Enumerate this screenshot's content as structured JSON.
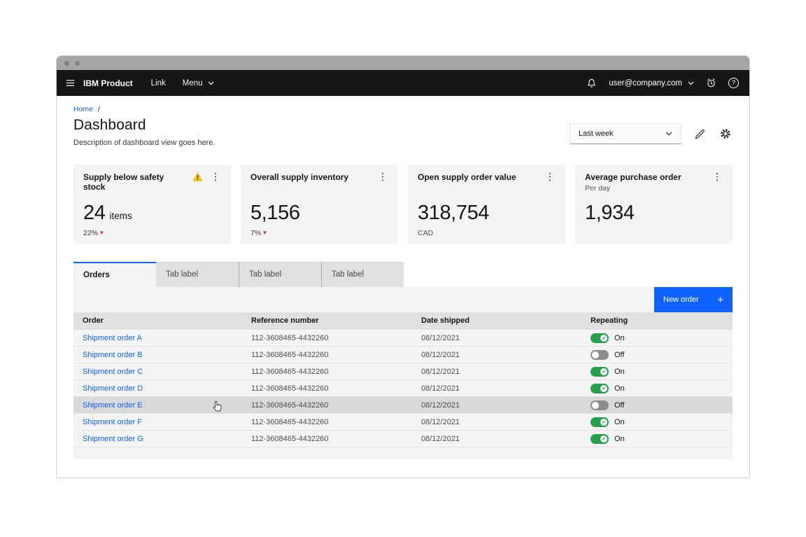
{
  "header": {
    "product": "IBM Product",
    "links": [
      "Link",
      "Menu"
    ],
    "user_email": "user@company.com"
  },
  "breadcrumb": {
    "home": "Home",
    "separator": "/"
  },
  "page": {
    "title": "Dashboard",
    "description": "Description of dashboard view goes here."
  },
  "filters": {
    "period": "Last week"
  },
  "cards": [
    {
      "title": "Supply below safety stock",
      "value": "24",
      "suffix": "items",
      "delta": "22%",
      "has_warning": true
    },
    {
      "title": "Overall supply inventory",
      "value": "5,156",
      "delta": "7%"
    },
    {
      "title": "Open supply order value",
      "value": "318,754",
      "footnote": "CAD"
    },
    {
      "title": "Average purchase order",
      "subtitle": "Per day",
      "value": "1,934"
    }
  ],
  "tabs": [
    {
      "label": "Orders",
      "active": true
    },
    {
      "label": "Tab label",
      "active": false
    },
    {
      "label": "Tab label",
      "active": false
    },
    {
      "label": "Tab label",
      "active": false
    }
  ],
  "table": {
    "new_order_label": "New order",
    "columns": [
      "Order",
      "Reference number",
      "Date shipped",
      "Repeating"
    ],
    "rows": [
      {
        "order": "Shipment order A",
        "reference": "112-3608465-4432260",
        "date_shipped": "08/12/2021",
        "state": "on",
        "state_label": "On",
        "hovered": false
      },
      {
        "order": "Shipment order B",
        "reference": "112-3608465-4432260",
        "date_shipped": "08/12/2021",
        "state": "off",
        "state_label": "Off",
        "hovered": false
      },
      {
        "order": "Shipment order C",
        "reference": "112-3608465-4432260",
        "date_shipped": "08/12/2021",
        "state": "on",
        "state_label": "On",
        "hovered": false
      },
      {
        "order": "Shipment order D",
        "reference": "112-3608465-4432260",
        "date_shipped": "08/12/2021",
        "state": "on",
        "state_label": "On",
        "hovered": false
      },
      {
        "order": "Shipment order E",
        "reference": "112-3608465-4432260",
        "date_shipped": "08/12/2021",
        "state": "off",
        "state_label": "Off",
        "hovered": true
      },
      {
        "order": "Shipment order F",
        "reference": "112-3608465-4432260",
        "date_shipped": "08/12/2021",
        "state": "on",
        "state_label": "On",
        "hovered": false
      },
      {
        "order": "Shipment order G",
        "reference": "112-3608465-4432260",
        "date_shipped": "08/12/2021",
        "state": "on",
        "state_label": "On",
        "hovered": false
      }
    ]
  },
  "icons": {
    "overflow": "⋮",
    "caret_down": "▾",
    "plus": "+",
    "help": "?"
  },
  "colors": {
    "accent": "#0f62fe",
    "header_bg": "#161616",
    "link": "#0f62fe",
    "toggle_on": "#24a148",
    "toggle_off": "#8d8d8d",
    "warning": "#f1c21b",
    "delta_negative": "#da1e28"
  }
}
